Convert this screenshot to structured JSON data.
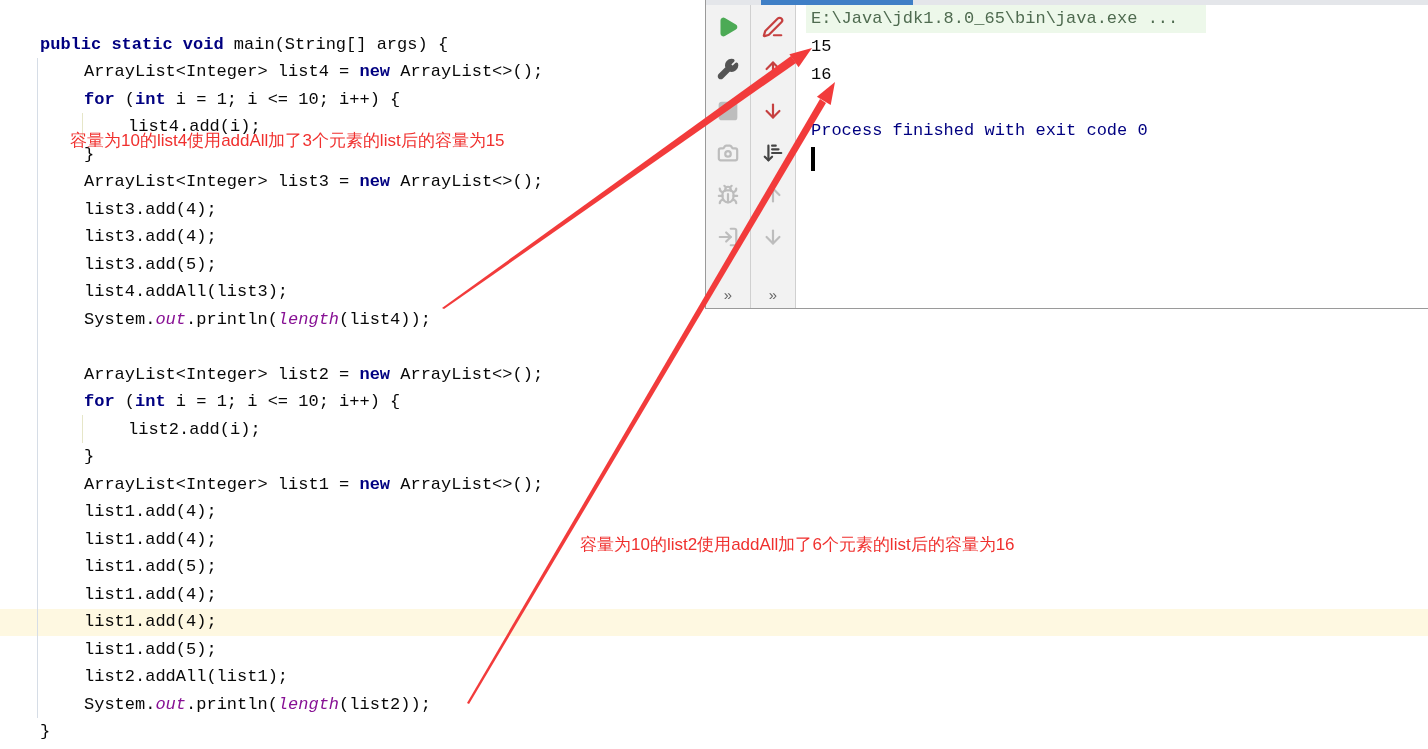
{
  "editor": {
    "lines": [
      {
        "current": false,
        "text": "**public static void** main(String[] args) {",
        "children": [
          {
            "current": false,
            "text": "ArrayList<Integer> list4 = **new** ArrayList<>();"
          },
          {
            "current": false,
            "text": "**for** (**int** i = 1; i <= 10; i++) {",
            "children": [
              {
                "current": false,
                "text": "list4.add(i);"
              }
            ]
          },
          {
            "current": false,
            "text": "}"
          },
          {
            "current": false,
            "text": "ArrayList<Integer> list3 = **new** ArrayList<>();"
          },
          {
            "current": false,
            "text": "list3.add(4);"
          },
          {
            "current": false,
            "text": "list3.add(4);"
          },
          {
            "current": false,
            "text": "list3.add(5);"
          },
          {
            "current": false,
            "text": "list4.addAll(list3);"
          },
          {
            "current": false,
            "text": "System.*out*.println(*length*(list4));"
          },
          {
            "current": false
          },
          {
            "current": false,
            "text": "ArrayList<Integer> list2 = **new** ArrayList<>();"
          },
          {
            "current": false,
            "text": "**for** (**int** i = 1; i <= 10; i++) {",
            "children": [
              {
                "current": false,
                "text": "list2.add(i);"
              }
            ]
          },
          {
            "current": false,
            "text": "}"
          },
          {
            "current": false,
            "text": "ArrayList<Integer> list1 = **new** ArrayList<>();"
          },
          {
            "current": false,
            "text": "list1.add(4);"
          },
          {
            "current": false,
            "text": "list1.add(4);"
          },
          {
            "current": false,
            "text": "list1.add(5);"
          },
          {
            "current": false,
            "text": "list1.add(4);"
          },
          {
            "current": true,
            "text": "list1.add(4);"
          },
          {
            "current": false,
            "text": "list1.add(5);"
          },
          {
            "current": false,
            "text": "list2.addAll(list1);"
          },
          {
            "current": false,
            "text": "System.*out*.println(*length*(list2));"
          }
        ]
      },
      {
        "current": false,
        "text": "}"
      }
    ]
  },
  "run_panel": {
    "toolbar_left": [
      {
        "disabled": false
      },
      {
        "disabled": false
      },
      {
        "disabled": true
      },
      {
        "disabled": true
      },
      {
        "disabled": true
      },
      {
        "disabled": true
      }
    ],
    "toolbar_left_more": "»",
    "toolbar_right": [
      {
        "disabled": false
      },
      {
        "disabled": false
      },
      {
        "disabled": false
      },
      {
        "disabled": false
      },
      {
        "disabled": true
      },
      {
        "disabled": true
      }
    ],
    "toolbar_right_more": "»",
    "console": [
      {
        "kind": "command",
        "text": "E:\\Java\\jdk1.8.0_65\\bin\\java.exe ..."
      },
      {
        "kind": "output",
        "text": "15"
      },
      {
        "kind": "output",
        "text": "16"
      },
      {
        "kind": "blank"
      },
      {
        "kind": "system",
        "text": "Process finished with exit code 0"
      },
      {
        "kind": "cursor"
      }
    ]
  },
  "annotations": [
    "容量为10的list4使用addAll加了3个元素的list后的容量为15",
    "容量为10的list2使用addAll加了6个元素的list后的容量为16"
  ]
}
